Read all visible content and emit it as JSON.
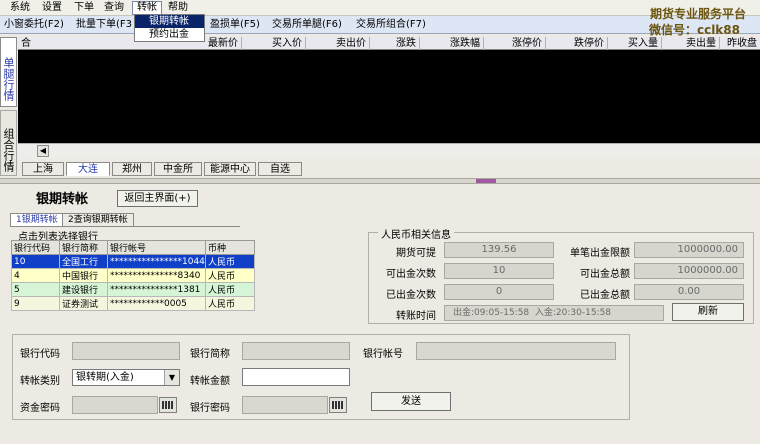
{
  "menu": {
    "items": [
      "系统",
      "设置",
      "下单",
      "查询",
      "转帐",
      "帮助"
    ],
    "active_index": 4,
    "dropdown": [
      "银期转帐",
      "预约出金"
    ]
  },
  "toolbar": {
    "items": [
      "小窗委托(F2)",
      "批量下单(F3",
      "盈损单(F5)",
      "交易所单腿(F6)",
      "交易所组合(F7)"
    ]
  },
  "brand": {
    "line1": "期货专业服务平台",
    "line2": "微信号：cclk88"
  },
  "quote": {
    "columns": [
      "合约",
      "最新价",
      "买入价",
      "卖出价",
      "涨跌",
      "涨跌幅",
      "涨停价",
      "跌停价",
      "买入量",
      "卖出量",
      "昨收盘"
    ]
  },
  "side_tabs": {
    "single": "单腿行情",
    "combo": "组合行情"
  },
  "market_tabs": [
    "上海",
    "大连",
    "郑州",
    "中金所",
    "能源中心",
    "自选"
  ],
  "market_active_index": 1,
  "transfer": {
    "title": "银期转帐",
    "back_label": "返回主界面(+)",
    "subtabs": [
      "1银期转帐",
      "2查询银期转帐"
    ],
    "list_hint": "点击列表选择银行",
    "bank_table": {
      "headers": [
        "银行代码",
        "银行简称",
        "银行帐号",
        "币种"
      ],
      "rows": [
        [
          "10",
          "全国工行",
          "****************1044",
          "人民币"
        ],
        [
          "4",
          "中国银行",
          "***************8340",
          "人民币"
        ],
        [
          "5",
          "建设银行",
          "***************1381",
          "人民币"
        ],
        [
          "9",
          "证券测试",
          "************0005",
          "人民币"
        ]
      ]
    },
    "rmb_info": {
      "title": "人民币相关信息",
      "withdrawable_label": "期货可提",
      "withdrawable": "139.56",
      "single_limit_label": "单笔出金限额",
      "single_limit": "1000000.00",
      "count_label": "可出金次数",
      "count": "10",
      "total_label": "可出金总额",
      "total": "1000000.00",
      "used_count_label": "已出金次数",
      "used_count": "0",
      "used_total_label": "已出金总额",
      "used_total": "0.00",
      "time_label": "转账时间",
      "time_value": "出金:09:05-15:58  入金:20:30-15:58",
      "refresh_label": "刷新"
    },
    "form": {
      "bank_code_label": "银行代码",
      "bank_name_label": "银行简称",
      "bank_account_label": "银行帐号",
      "type_label": "转帐类别",
      "type_value": "银转期(入金)",
      "amount_label": "转帐金额",
      "fund_pwd_label": "资金密码",
      "bank_pwd_label": "银行密码",
      "send_label": "发送"
    }
  }
}
